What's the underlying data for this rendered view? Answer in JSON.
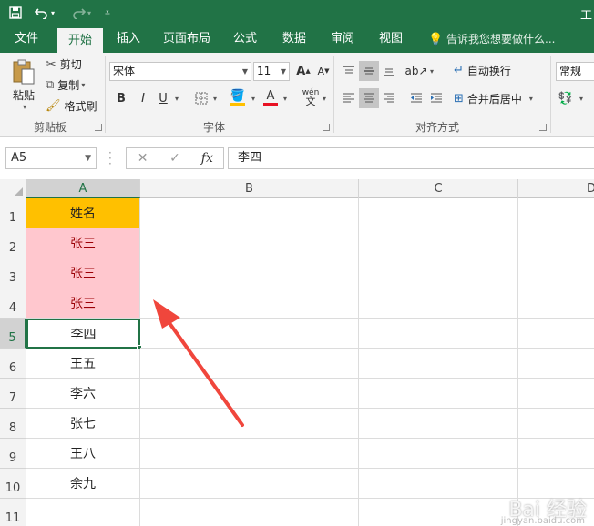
{
  "app": {
    "title_fragment": "工",
    "accent_color": "#217346"
  },
  "quick_access": {
    "save_icon": "save-icon",
    "undo_icon": "undo-icon",
    "redo_icon": "redo-icon",
    "customize_icon": "customize-qat-icon"
  },
  "tabs": [
    {
      "label": "文件"
    },
    {
      "label": "开始",
      "active": true
    },
    {
      "label": "插入"
    },
    {
      "label": "页面布局"
    },
    {
      "label": "公式"
    },
    {
      "label": "数据"
    },
    {
      "label": "审阅"
    },
    {
      "label": "视图"
    }
  ],
  "tell_me": "告诉我您想要做什么...",
  "clipboard": {
    "paste": "粘贴",
    "cut": "剪切",
    "copy": "复制",
    "format_painter": "格式刷",
    "group_label": "剪贴板"
  },
  "font": {
    "name": "宋体",
    "size": "11",
    "bold": "B",
    "italic": "I",
    "underline": "U",
    "phonetic": "wén",
    "group_label": "字体"
  },
  "alignment": {
    "wrap_text": "自动换行",
    "merge_center": "合并后居中",
    "group_label": "对齐方式"
  },
  "number": {
    "format": "常规"
  },
  "formula_bar": {
    "name_box": "A5",
    "fx": "fx",
    "content": "李四"
  },
  "columns": [
    {
      "label": "A",
      "selected": true
    },
    {
      "label": "B"
    },
    {
      "label": "C"
    },
    {
      "label": "D"
    }
  ],
  "rows": [
    {
      "num": "1",
      "a": "姓名",
      "style": "header"
    },
    {
      "num": "2",
      "a": "张三",
      "style": "dup"
    },
    {
      "num": "3",
      "a": "张三",
      "style": "dup"
    },
    {
      "num": "4",
      "a": "张三",
      "style": "dup"
    },
    {
      "num": "5",
      "a": "李四",
      "style": "active"
    },
    {
      "num": "6",
      "a": "王五",
      "style": ""
    },
    {
      "num": "7",
      "a": "李六",
      "style": ""
    },
    {
      "num": "8",
      "a": "张七",
      "style": ""
    },
    {
      "num": "9",
      "a": "王八",
      "style": ""
    },
    {
      "num": "10",
      "a": "余九",
      "style": ""
    },
    {
      "num": "11",
      "a": "",
      "style": ""
    }
  ],
  "colors": {
    "header_fill": "#ffc000",
    "duplicate_fill": "#ffc7ce",
    "duplicate_text": "#9c0006",
    "arrow": "#f0463c"
  },
  "watermark": {
    "logo": "Bai 经验",
    "url": "jingyan.baidu.com"
  }
}
